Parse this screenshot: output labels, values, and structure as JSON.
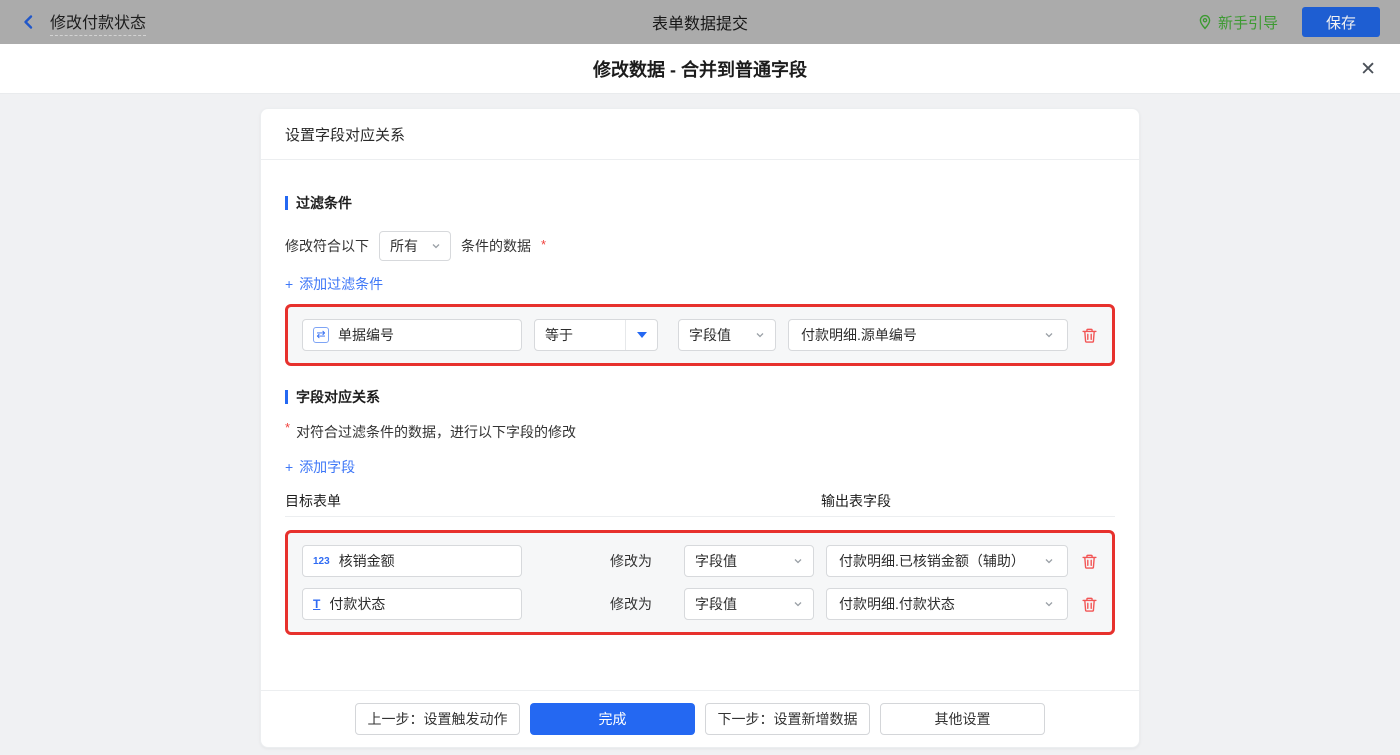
{
  "topbar": {
    "back_label": "修改付款状态",
    "center_title": "表单数据提交",
    "guide_label": "新手引导",
    "save_label": "保存"
  },
  "modal": {
    "title": "修改数据 - 合并到普通字段",
    "close_glyph": "✕"
  },
  "panel": {
    "header": "设置字段对应关系",
    "filter": {
      "title": "过滤条件",
      "condition_prefix": "修改符合以下",
      "condition_select_value": "所有",
      "condition_suffix": "条件的数据",
      "required_mark": "*",
      "add_link_label": "添加过滤条件",
      "rows": [
        {
          "field_icon": "serial-number",
          "field_name": "单据编号",
          "operator": "等于",
          "value_type": "字段值",
          "value": "付款明细.源单编号"
        }
      ]
    },
    "mapping": {
      "title": "字段对应关系",
      "required_mark": "*",
      "description": "对符合过滤条件的数据，进行以下字段的修改",
      "add_link_label": "添加字段",
      "col_target": "目标表单",
      "col_output": "输出表字段",
      "rows": [
        {
          "field_icon": "number",
          "field_name": "核销金额",
          "modify_label": "修改为",
          "value_type": "字段值",
          "value": "付款明细.已核销金额（辅助）"
        },
        {
          "field_icon": "text",
          "field_name": "付款状态",
          "modify_label": "修改为",
          "value_type": "字段值",
          "value": "付款明细.付款状态"
        }
      ]
    },
    "footer": {
      "prev_label": "上一步：设置触发动作",
      "done_label": "完成",
      "next_label": "下一步：设置新增数据",
      "other_label": "其他设置"
    }
  },
  "icons": {
    "plus": "+",
    "serial_glyph": "⇄",
    "number_glyph": "123",
    "text_glyph": "T"
  },
  "colors": {
    "accent_blue": "#2468f2",
    "link_blue": "#3e77f7",
    "highlight_red_border": "#e7312d",
    "trash_red": "#f25555",
    "guide_green": "#3c9a31",
    "save_button_blue": "#1e5ed2",
    "required_red": "#f0403c",
    "page_background": "#f0f1f3"
  }
}
